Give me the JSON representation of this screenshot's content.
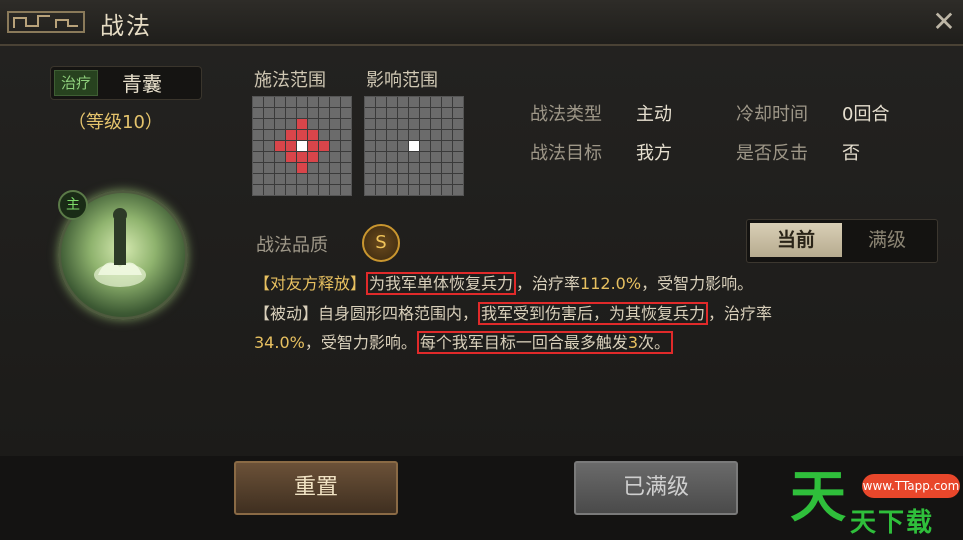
{
  "window": {
    "title": "战法",
    "close_icon": "close-icon"
  },
  "skill": {
    "type_badge": "治疗",
    "name": "青囊",
    "level": "（等级10）",
    "role_badge": "主"
  },
  "grids": {
    "cast_label": "施法范围",
    "effect_label": "影响范围"
  },
  "info": {
    "type_label": "战法类型",
    "type_value": "主动",
    "cooldown_label": "冷却时间",
    "cooldown_value": "0回合",
    "target_label": "战法目标",
    "target_value": "我方",
    "counter_label": "是否反击",
    "counter_value": "否"
  },
  "quality": {
    "label": "战法品质",
    "grade": "S"
  },
  "toggle": {
    "current": "当前",
    "max": "满级"
  },
  "description": {
    "line1_a": "【对友方释放】",
    "line1_b": "为我军单体恢复兵力",
    "line1_c": "，治疗率",
    "line1_d": "112.0%",
    "line1_e": "，受智力影响。",
    "line2_a": "【被动】自身圆形四格范围内，",
    "line2_b": "我军受到伤害后，为其恢复兵力",
    "line2_c": "，治疗率",
    "line3_a": "34.0%",
    "line3_b": "，受智力影响。",
    "line3_c": "每个我军目标一回合最多触发",
    "line3_d": "3",
    "line3_e": "次。"
  },
  "buttons": {
    "reset": "重置",
    "maxed": "已满级"
  },
  "watermark": {
    "badge": "www.TTapp.com",
    "text": "天下载"
  },
  "colors": {
    "highlight_box": "#e02a2a",
    "cast_range": "#d9454a",
    "accent_yellow": "#e7c060"
  }
}
